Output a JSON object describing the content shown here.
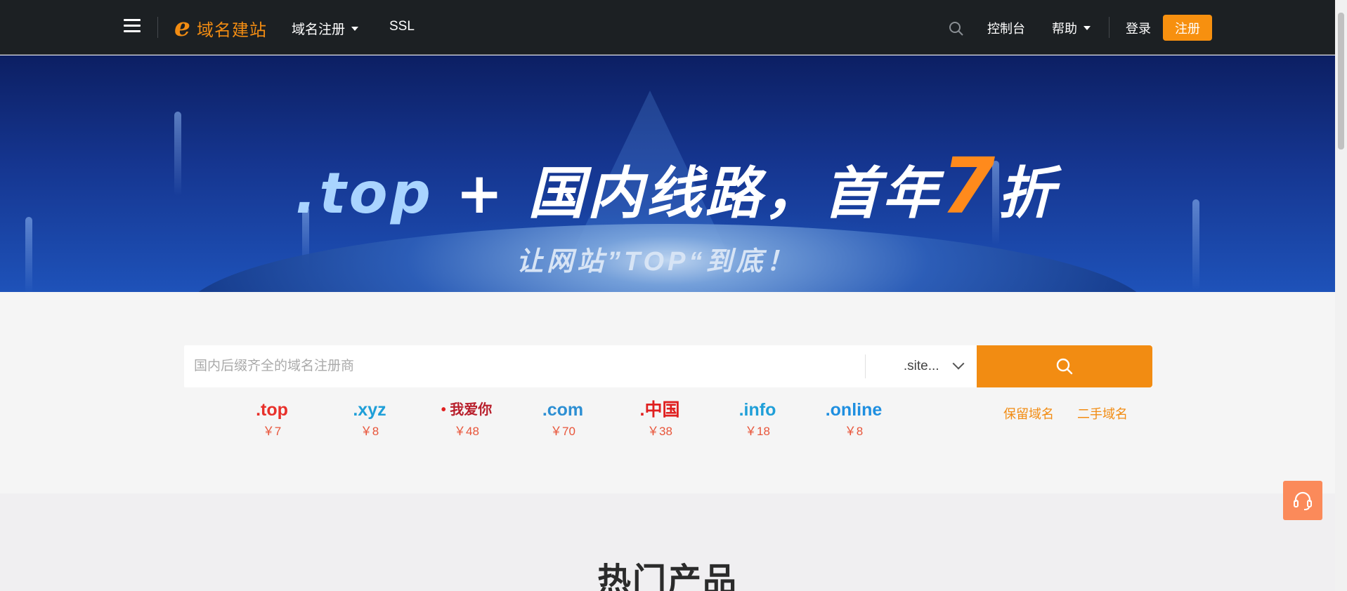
{
  "header": {
    "logo_text": "域名建站",
    "nav": [
      {
        "label": "域名注册",
        "has_dropdown": true
      },
      {
        "label": "SSL",
        "has_dropdown": false
      }
    ],
    "console_label": "控制台",
    "help_label": "帮助",
    "login_label": "登录",
    "register_label": "注册"
  },
  "banner": {
    "headline_tld": ".top",
    "headline_rest": " + 国内线路，首年",
    "headline_number": "7",
    "headline_end": "折",
    "subline": "让网站”TOP“到底！"
  },
  "search": {
    "placeholder": "国内后缀齐全的域名注册商",
    "suffix_selected": ".site...",
    "icons": {
      "search": "search-icon",
      "dropdown": "chevron-down-icon"
    }
  },
  "tlds": [
    {
      "name": ".top",
      "price": "￥7",
      "color": "#e8302a"
    },
    {
      "name": ".xyz",
      "price": "￥8",
      "color": "#1f9fd8"
    },
    {
      "name": "我爱你",
      "price": "￥48",
      "color": "#b81f2c"
    },
    {
      "name": ".com",
      "price": "￥70",
      "color": "#2d8fd3"
    },
    {
      "name": ".中国",
      "price": "￥38",
      "color": "#e02020"
    },
    {
      "name": ".info",
      "price": "￥18",
      "color": "#1f9fd8"
    },
    {
      "name": ".online",
      "price": "￥8",
      "color": "#1f8fe0"
    }
  ],
  "side_links": {
    "reserved": "保留域名",
    "secondhand": "二手域名"
  },
  "products": {
    "title": "热门产品"
  },
  "colors": {
    "accent": "#f28c12",
    "topbar": "#1c2023"
  }
}
